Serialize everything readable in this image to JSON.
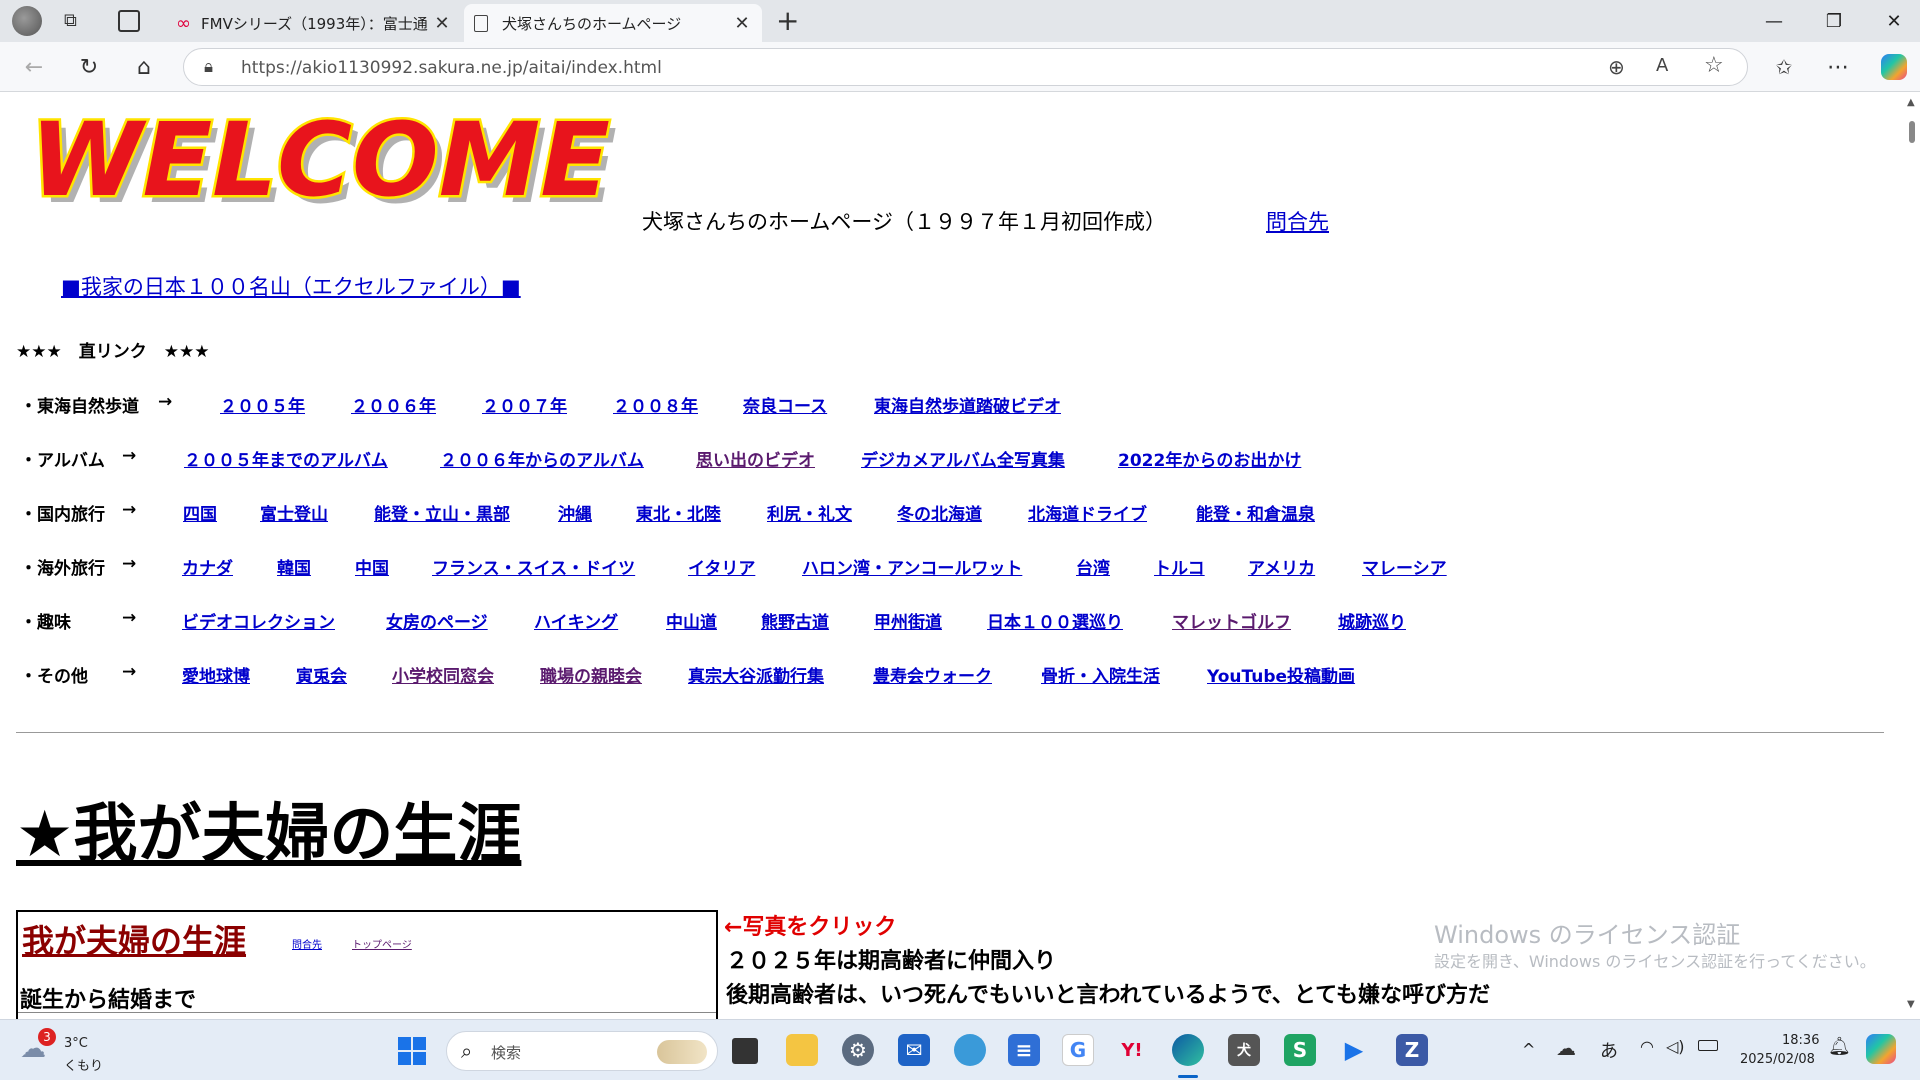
{
  "browser": {
    "tabs": [
      {
        "title": "FMVシリーズ（1993年）：富士通",
        "close": "✕"
      },
      {
        "title": "犬塚さんちのホームページ",
        "close": "✕"
      }
    ],
    "new_tab": "+",
    "url": "https://akio1130992.sakura.ne.jp/aitai/index.html",
    "window_controls": {
      "minimize": "—",
      "maximize": "❐",
      "close": "✕"
    }
  },
  "page": {
    "welcome_logo": "WELCOME",
    "site_title": "犬塚さんちのホームページ（１９９７年１月初回作成）",
    "contact_link": "問合先",
    "mountains_link": "■我家の日本１００名山（エクセルファイル）■",
    "direct_links_heading": "★★★　直リンク　★★★",
    "rows": [
      {
        "label": "・東海自然歩道",
        "arrow": "→",
        "links": [
          "２００５年",
          "２００６年",
          "２００７年",
          "２００８年",
          "奈良コース",
          "東海自然歩道踏破ビデオ"
        ]
      },
      {
        "label": "・アルバム",
        "arrow": "→",
        "links": [
          "２００５年までのアルバム",
          "２００６年からのアルバム",
          "思い出のビデオ",
          "デジカメアルバム全写真集",
          "2022年からのお出かけ"
        ]
      },
      {
        "label": "・国内旅行",
        "arrow": "→",
        "links": [
          "四国",
          "富士登山",
          "能登・立山・黒部",
          "沖縄",
          "東北・北陸",
          "利尻・礼文",
          "冬の北海道",
          "北海道ドライブ",
          "能登・和倉温泉"
        ]
      },
      {
        "label": "・海外旅行",
        "arrow": "→",
        "links": [
          "カナダ",
          "韓国",
          "中国",
          "フランス・スイス・ドイツ",
          "イタリア",
          "ハロン湾・アンコールワット",
          "台湾",
          "トルコ",
          "アメリカ",
          "マレーシア"
        ]
      },
      {
        "label": "・趣味",
        "arrow": "→",
        "links": [
          "ビデオコレクション",
          "女房のページ",
          "ハイキング",
          "中山道",
          "熊野古道",
          "甲州街道",
          "日本１００選巡り",
          "マレットゴルフ",
          "城跡巡り"
        ]
      },
      {
        "label": "・その他",
        "arrow": "→",
        "links": [
          "愛地球博",
          "寅兎会",
          "小学校同窓会",
          "職場の親睦会",
          "真宗大谷派勤行集",
          "豊寿会ウォーク",
          "骨折・入院生活",
          "YouTube投稿動画"
        ]
      }
    ],
    "section_heading": "★我が夫婦の生涯",
    "preview": {
      "title": "我が夫婦の生涯",
      "small_link1": "問合先",
      "small_link2": "トップページ",
      "subtitle": "誕生から結婚まで"
    },
    "photo_note": "←写真をクリック",
    "text_line1": "２０２５年は期高齢者に仲間入り",
    "text_line2": "後期高齢者は、いつ死んでもいいと言われているようで、とても嫌な呼び方だ"
  },
  "watermark": {
    "line1": "Windows のライセンス認証",
    "line2": "設定を開き、Windows のライセンス認証を行ってください。"
  },
  "taskbar": {
    "weather_badge": "3",
    "weather_temp": "3°C",
    "weather_desc": "くもり",
    "search_placeholder": "検索",
    "ime": "あ",
    "time": "18:36",
    "date": "2025/02/08",
    "chevron": "^"
  },
  "colors": {
    "link": "#0000cc",
    "visited": "#5a1a6e",
    "note_red": "#e00000",
    "welcome_red": "#e8141c",
    "welcome_yellow": "#ffe400"
  }
}
